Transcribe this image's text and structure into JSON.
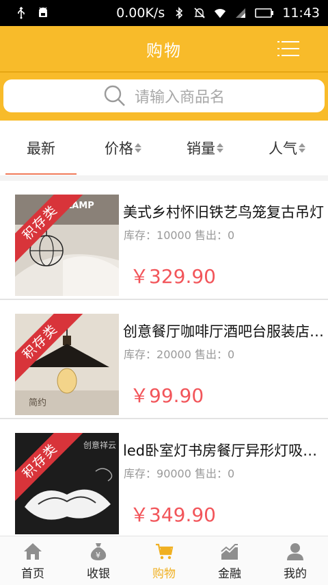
{
  "status_bar": {
    "network_speed": "0.00K/s",
    "time": "11:43"
  },
  "header": {
    "title": "购物"
  },
  "search": {
    "placeholder": "请输入商品名"
  },
  "sort_tabs": [
    {
      "label": "最新",
      "active": true
    },
    {
      "label": "价格",
      "active": false
    },
    {
      "label": "销量",
      "active": false
    },
    {
      "label": "人气",
      "active": false
    }
  ],
  "products": [
    {
      "name": "美式乡村怀旧铁艺鸟笼复古吊灯",
      "stock_label": "库存：",
      "stock": "10000",
      "sold_label": "售出：",
      "sold": "0",
      "price": "￥329.90",
      "ribbon": "积存类",
      "thumb_caption": "R·LAMP"
    },
    {
      "name": "创意餐厅咖啡厅酒吧台服装店吊灯",
      "stock_label": "库存：",
      "stock": "20000",
      "sold_label": "售出：",
      "sold": "0",
      "price": "￥99.90",
      "ribbon": "积存类",
      "thumb_caption": "简约"
    },
    {
      "name": "led卧室灯书房餐厅异形灯吸顶灯",
      "stock_label": "库存：",
      "stock": "90000",
      "sold_label": "售出：",
      "sold": "0",
      "price": "￥349.90",
      "ribbon": "积存类",
      "thumb_caption": "创意祥云"
    }
  ],
  "bottom_nav": [
    {
      "label": "首页",
      "icon": "home-icon",
      "active": false
    },
    {
      "label": "收银",
      "icon": "money-bag-icon",
      "active": false
    },
    {
      "label": "购物",
      "icon": "cart-icon",
      "active": true
    },
    {
      "label": "金融",
      "icon": "chart-icon",
      "active": false
    },
    {
      "label": "我的",
      "icon": "user-icon",
      "active": false
    }
  ],
  "colors": {
    "accent": "#f8bb2a",
    "price": "#f2555a",
    "ribbon": "#d8343a",
    "active_nav": "#f0b022"
  }
}
